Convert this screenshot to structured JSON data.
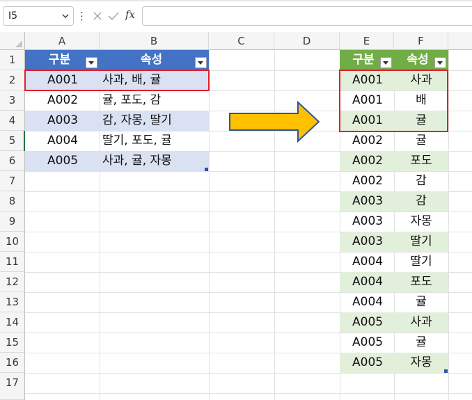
{
  "formula_bar": {
    "name_box": "I5",
    "dots": "⋮",
    "fx": "fx",
    "formula": ""
  },
  "columns": [
    "A",
    "B",
    "C",
    "D",
    "E",
    "F"
  ],
  "rows": [
    "1",
    "2",
    "3",
    "4",
    "5",
    "6",
    "7",
    "8",
    "9",
    "10",
    "11",
    "12",
    "13",
    "14",
    "15",
    "16",
    "17"
  ],
  "left_table": {
    "headers": [
      "구분",
      "속성"
    ],
    "rows": [
      [
        "A001",
        "사과, 배, 귤"
      ],
      [
        "A002",
        "귤, 포도, 감"
      ],
      [
        "A003",
        "감, 자몽, 딸기"
      ],
      [
        "A004",
        "딸기, 포도, 귤"
      ],
      [
        "A005",
        "사과, 귤, 자몽"
      ]
    ],
    "header_color": "#4472c4",
    "band_color": "#d9e1f2"
  },
  "right_table": {
    "headers": [
      "구분",
      "속성"
    ],
    "rows": [
      [
        "A001",
        "사과"
      ],
      [
        "A001",
        "배"
      ],
      [
        "A001",
        "귤"
      ],
      [
        "A002",
        "귤"
      ],
      [
        "A002",
        "포도"
      ],
      [
        "A002",
        "감"
      ],
      [
        "A003",
        "감"
      ],
      [
        "A003",
        "자몽"
      ],
      [
        "A003",
        "딸기"
      ],
      [
        "A004",
        "딸기"
      ],
      [
        "A004",
        "포도"
      ],
      [
        "A004",
        "귤"
      ],
      [
        "A005",
        "사과"
      ],
      [
        "A005",
        "귤"
      ],
      [
        "A005",
        "자몽"
      ]
    ],
    "header_color": "#70ad47",
    "band_color": "#e2efda"
  },
  "arrow_color": "#ffc000",
  "highlight_color": "#e0202a"
}
